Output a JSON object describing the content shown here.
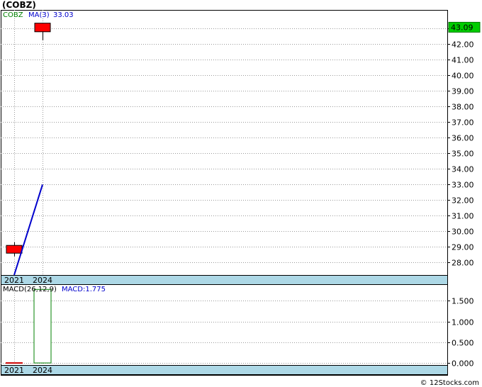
{
  "header": {
    "title": "(COBZ)"
  },
  "footer": {
    "credit": "© 12Stocks.com"
  },
  "chart_data": [
    {
      "type": "candlestick",
      "legend": {
        "symbol": "COBZ",
        "ma_label": "MA(3)",
        "ma_value": "33.03"
      },
      "current_price_label": "43.09",
      "x_ticks": [
        "2021",
        "2024"
      ],
      "y_ticks": [
        "28.00",
        "29.00",
        "30.00",
        "31.00",
        "32.00",
        "33.00",
        "34.00",
        "35.00",
        "36.00",
        "37.00",
        "38.00",
        "39.00",
        "40.00",
        "41.00",
        "42.00",
        "43.00"
      ],
      "ylim": [
        27.2,
        44.2
      ],
      "candles": [
        {
          "x": "2021",
          "open": 28.6,
          "close": 29.1,
          "high": 29.3,
          "low": 28.4
        },
        {
          "x": "2024",
          "open": 42.8,
          "close": 43.35,
          "high": 43.35,
          "low": 42.25
        }
      ],
      "ma_line": [
        {
          "x": "2021",
          "y": 27.2
        },
        {
          "x": "2024",
          "y": 33.0
        }
      ],
      "colors": {
        "candle": "#ff0000",
        "ma": "#0000cc",
        "price_tag": "#00cc00",
        "symbol_text": "#008000"
      },
      "grid": true
    },
    {
      "type": "bar",
      "legend": {
        "label": "MACD(26,12,9)",
        "value_label": "MACD:1.775"
      },
      "x_ticks": [
        "2021",
        "2024"
      ],
      "y_ticks": [
        "0.000",
        "0.500",
        "1.000",
        "1.500"
      ],
      "ylim": [
        -0.05,
        1.9
      ],
      "bars": [
        {
          "x": "2021",
          "value": 0.0
        },
        {
          "x": "2024",
          "value": 1.775
        }
      ],
      "colors": {
        "bar_outline": "#008000",
        "zero_line": "#cc0000"
      },
      "grid": true
    }
  ]
}
